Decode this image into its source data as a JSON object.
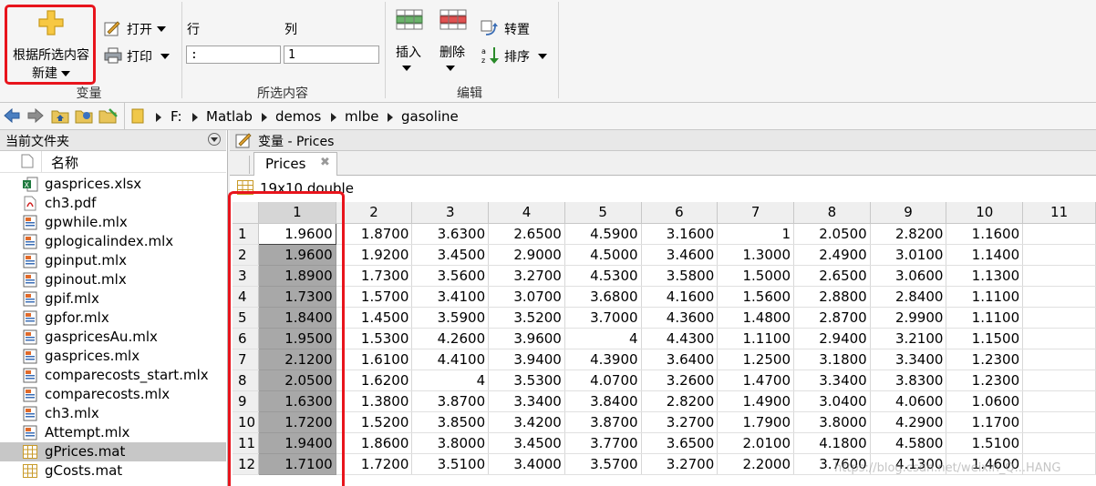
{
  "toolstrip": {
    "new_from_selection": "根据所选内容",
    "new_label": "新建",
    "open_label": "打开",
    "print_label": "打印",
    "group_variable": "变量",
    "row_label": "行",
    "col_label": "列",
    "row_value": ":",
    "col_value": "1",
    "group_selection": "所选内容",
    "insert_label": "插入",
    "delete_label": "删除",
    "transpose_label": "转置",
    "sort_label": "排序",
    "group_edit": "编辑"
  },
  "path": [
    "F:",
    "Matlab",
    "demos",
    "mlbe",
    "gasoline"
  ],
  "file_panel": {
    "title": "当前文件夹",
    "column_name": "名称",
    "files": [
      {
        "name": "gasprices.xlsx",
        "icon": "excel-file-icon"
      },
      {
        "name": "ch3.pdf",
        "icon": "pdf-file-icon"
      },
      {
        "name": "gpwhile.mlx",
        "icon": "live-script-icon"
      },
      {
        "name": "gplogicalindex.mlx",
        "icon": "live-script-icon"
      },
      {
        "name": "gpinput.mlx",
        "icon": "live-script-icon"
      },
      {
        "name": "gpinout.mlx",
        "icon": "live-script-icon"
      },
      {
        "name": "gpif.mlx",
        "icon": "live-script-icon"
      },
      {
        "name": "gpfor.mlx",
        "icon": "live-script-icon"
      },
      {
        "name": "gaspricesAu.mlx",
        "icon": "live-script-icon"
      },
      {
        "name": "gasprices.mlx",
        "icon": "live-script-icon"
      },
      {
        "name": "comparecosts_start.mlx",
        "icon": "live-script-icon"
      },
      {
        "name": "comparecosts.mlx",
        "icon": "live-script-icon"
      },
      {
        "name": "ch3.mlx",
        "icon": "live-script-icon"
      },
      {
        "name": "Attempt.mlx",
        "icon": "live-script-icon"
      },
      {
        "name": "gPrices.mat",
        "icon": "mat-file-icon",
        "selected": true
      },
      {
        "name": "gCosts.mat",
        "icon": "mat-file-icon"
      }
    ]
  },
  "variable_editor": {
    "title": "变量 - Prices",
    "tab": "Prices",
    "size_label": "19x10 double",
    "col_headers": [
      "1",
      "2",
      "3",
      "4",
      "5",
      "6",
      "7",
      "8",
      "9",
      "10",
      "11"
    ],
    "rows": [
      [
        "1",
        "1.9600",
        "1.8700",
        "3.6300",
        "2.6500",
        "4.5900",
        "3.1600",
        "1",
        "2.0500",
        "2.8200",
        "1.1600"
      ],
      [
        "2",
        "1.9600",
        "1.9200",
        "3.4500",
        "2.9000",
        "4.5000",
        "3.4600",
        "1.3000",
        "2.4900",
        "3.0100",
        "1.1400"
      ],
      [
        "3",
        "1.8900",
        "1.7300",
        "3.5600",
        "3.2700",
        "4.5300",
        "3.5800",
        "1.5000",
        "2.6500",
        "3.0600",
        "1.1300"
      ],
      [
        "4",
        "1.7300",
        "1.5700",
        "3.4100",
        "3.0700",
        "3.6800",
        "4.1600",
        "1.5600",
        "2.8800",
        "2.8400",
        "1.1100"
      ],
      [
        "5",
        "1.8400",
        "1.4500",
        "3.5900",
        "3.5200",
        "3.7000",
        "4.3600",
        "1.4800",
        "2.8700",
        "2.9900",
        "1.1100"
      ],
      [
        "6",
        "1.9500",
        "1.5300",
        "4.2600",
        "3.9600",
        "4",
        "4.4300",
        "1.1100",
        "2.9400",
        "3.2100",
        "1.1500"
      ],
      [
        "7",
        "2.1200",
        "1.6100",
        "4.4100",
        "3.9400",
        "4.3900",
        "3.6400",
        "1.2500",
        "3.1800",
        "3.3400",
        "1.2300"
      ],
      [
        "8",
        "2.0500",
        "1.6200",
        "4",
        "3.5300",
        "4.0700",
        "3.2600",
        "1.4700",
        "3.3400",
        "3.8300",
        "1.2300"
      ],
      [
        "9",
        "1.6300",
        "1.3800",
        "3.8700",
        "3.3400",
        "3.8400",
        "2.8200",
        "1.4900",
        "3.0400",
        "4.0600",
        "1.0600"
      ],
      [
        "10",
        "1.7200",
        "1.5200",
        "3.8500",
        "3.4200",
        "3.8700",
        "3.2700",
        "1.7900",
        "3.8000",
        "4.2900",
        "1.1700"
      ],
      [
        "11",
        "1.9400",
        "1.8600",
        "3.8000",
        "3.4500",
        "3.7700",
        "3.6500",
        "2.0100",
        "4.1800",
        "4.5800",
        "1.5100"
      ],
      [
        "12",
        "1.7100",
        "1.7200",
        "3.5100",
        "3.4000",
        "3.5700",
        "3.2700",
        "2.2000",
        "3.7600",
        "4.1300",
        "1.4600"
      ]
    ]
  },
  "watermark": "https://blog.csdn.net/weixin_Q...HANG",
  "colors": {
    "highlight": "#e8141c",
    "selection": "#a8a8a8"
  }
}
